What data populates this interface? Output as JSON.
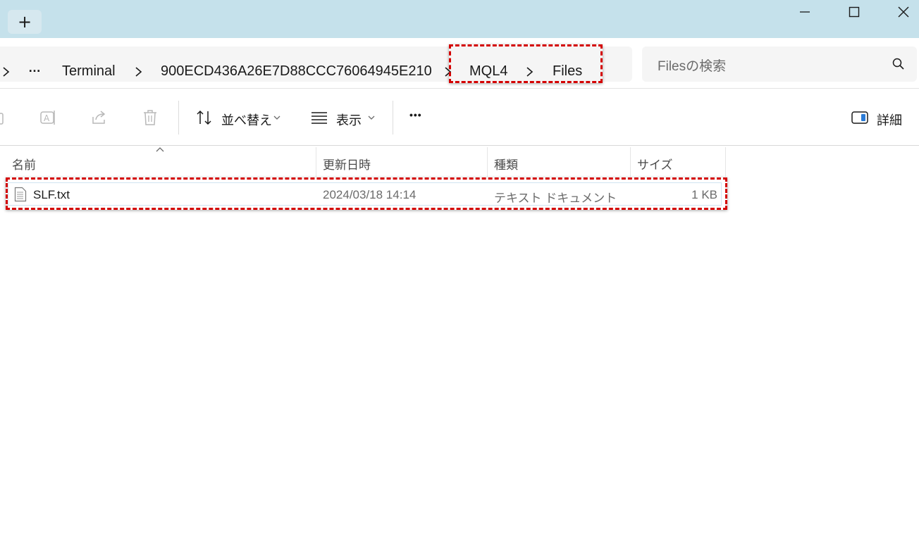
{
  "titlebar": {
    "new_tab_label": "+",
    "minimize_icon": "minimize-icon",
    "maximize_icon": "maximize-icon",
    "close_icon": "close-icon"
  },
  "address": {
    "overflow_label": "…",
    "crumbs": [
      "Terminal",
      "900ECD436A26E7D88CCC76064945E210",
      "MQL4",
      "Files"
    ],
    "search_placeholder": "Filesの検索"
  },
  "toolbar": {
    "sort_label": "並べ替え",
    "view_label": "表示",
    "more_label": "•••",
    "details_label": "詳細"
  },
  "columns": [
    "名前",
    "更新日時",
    "種類",
    "サイズ"
  ],
  "files": [
    {
      "name": "SLF.txt",
      "modified": "2024/03/18 14:14",
      "type": "テキスト ドキュメント",
      "size": "1 KB"
    }
  ],
  "colors": {
    "titlebar": "#c5e1eb",
    "highlight": "#d40000",
    "row_border": "#cfe3f1"
  }
}
